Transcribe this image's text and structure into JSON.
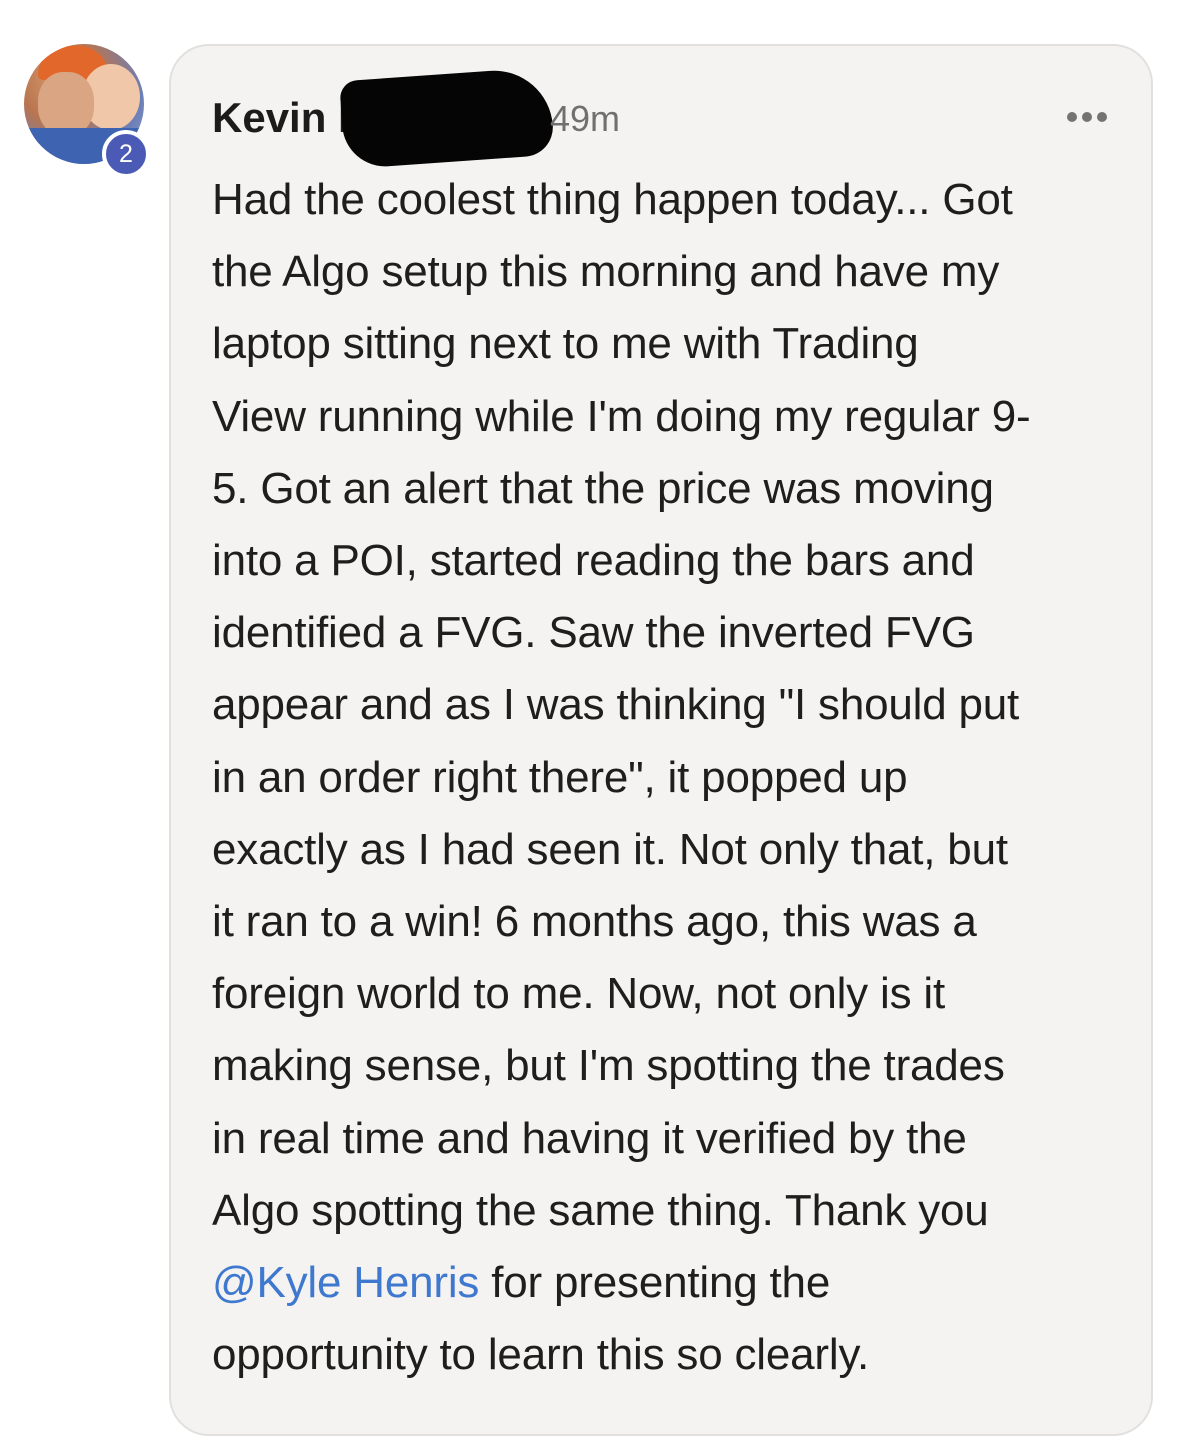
{
  "avatar": {
    "badge_count": "2",
    "icon": "user-photo-avatar"
  },
  "post": {
    "author": "Kevin K",
    "time": "49m",
    "menu_icon": "more-horizontal-icon",
    "lines": [
      "Had the coolest thing happen today... Got",
      "the Algo setup this morning and have my",
      "laptop sitting next to me with Trading",
      "View running while I'm doing my regular 9-",
      "5. Got an alert that the price was moving",
      "into a POI, started reading the bars and",
      "identified a FVG. Saw the inverted FVG",
      "appear and as I was thinking \"I should put",
      "in an order right there\", it popped up",
      "exactly as I had seen it. Not only that, but",
      "it ran to a win! 6 months ago, this was a",
      "foreign world to me. Now, not only is it",
      "making sense, but I'm spotting the trades",
      "in real time and having it verified by the",
      "Algo spotting the same thing. Thank you"
    ],
    "mention": "@Kyle Henris",
    "mention_suffix": " for presenting the",
    "last_line": "opportunity to learn this so clearly.",
    "mention_color": "#3f78cf"
  }
}
